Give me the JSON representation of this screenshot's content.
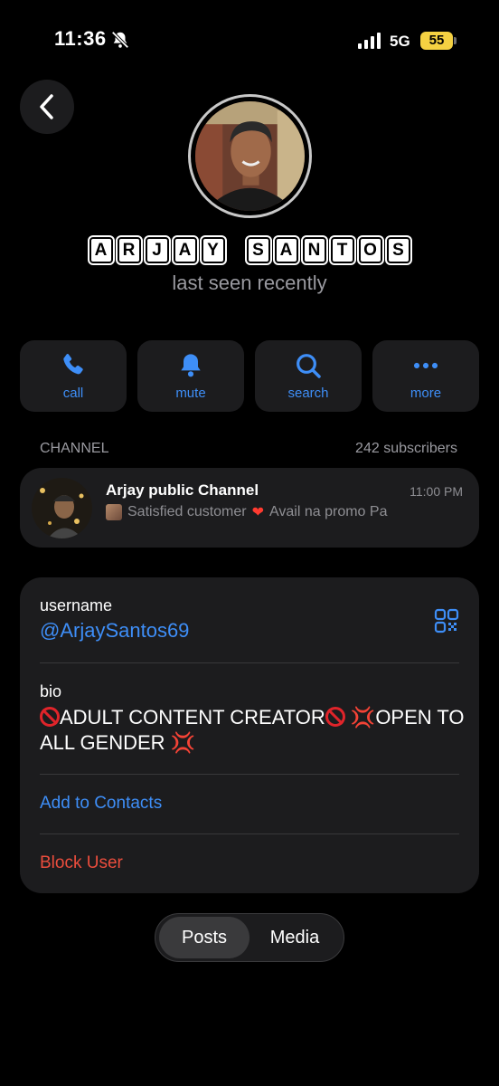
{
  "status_bar": {
    "time": "11:36",
    "network": "5G",
    "battery": "55"
  },
  "profile": {
    "name_letters": [
      "A",
      "R",
      "J",
      "A",
      "Y",
      " ",
      "S",
      "A",
      "N",
      "T",
      "O",
      "S"
    ],
    "status": "last seen recently"
  },
  "actions": [
    {
      "label": "call",
      "icon": "phone-icon"
    },
    {
      "label": "mute",
      "icon": "bell-icon"
    },
    {
      "label": "search",
      "icon": "search-icon"
    },
    {
      "label": "more",
      "icon": "more-icon"
    }
  ],
  "channel": {
    "section_label": "CHANNEL",
    "subscribers": "242 subscribers",
    "name": "Arjay public Channel",
    "time": "11:00 PM",
    "preview_a": "Satisfied customer",
    "preview_b": "Avail na promo Pa"
  },
  "info": {
    "username_label": "username",
    "username": "@ArjaySantos69",
    "bio_label": "bio",
    "bio_part1": "ADULT CONTENT CREATOR",
    "bio_part2": "OPEN TO ALL GENDER",
    "add_contacts": "Add to Contacts",
    "block_user": "Block User"
  },
  "tabs": [
    {
      "label": "Posts",
      "active": true
    },
    {
      "label": "Media",
      "active": false
    }
  ],
  "colors": {
    "accent": "#3e8ef7",
    "danger": "#eb4d3d",
    "card": "#1c1c1e",
    "battery": "#f5d142"
  }
}
